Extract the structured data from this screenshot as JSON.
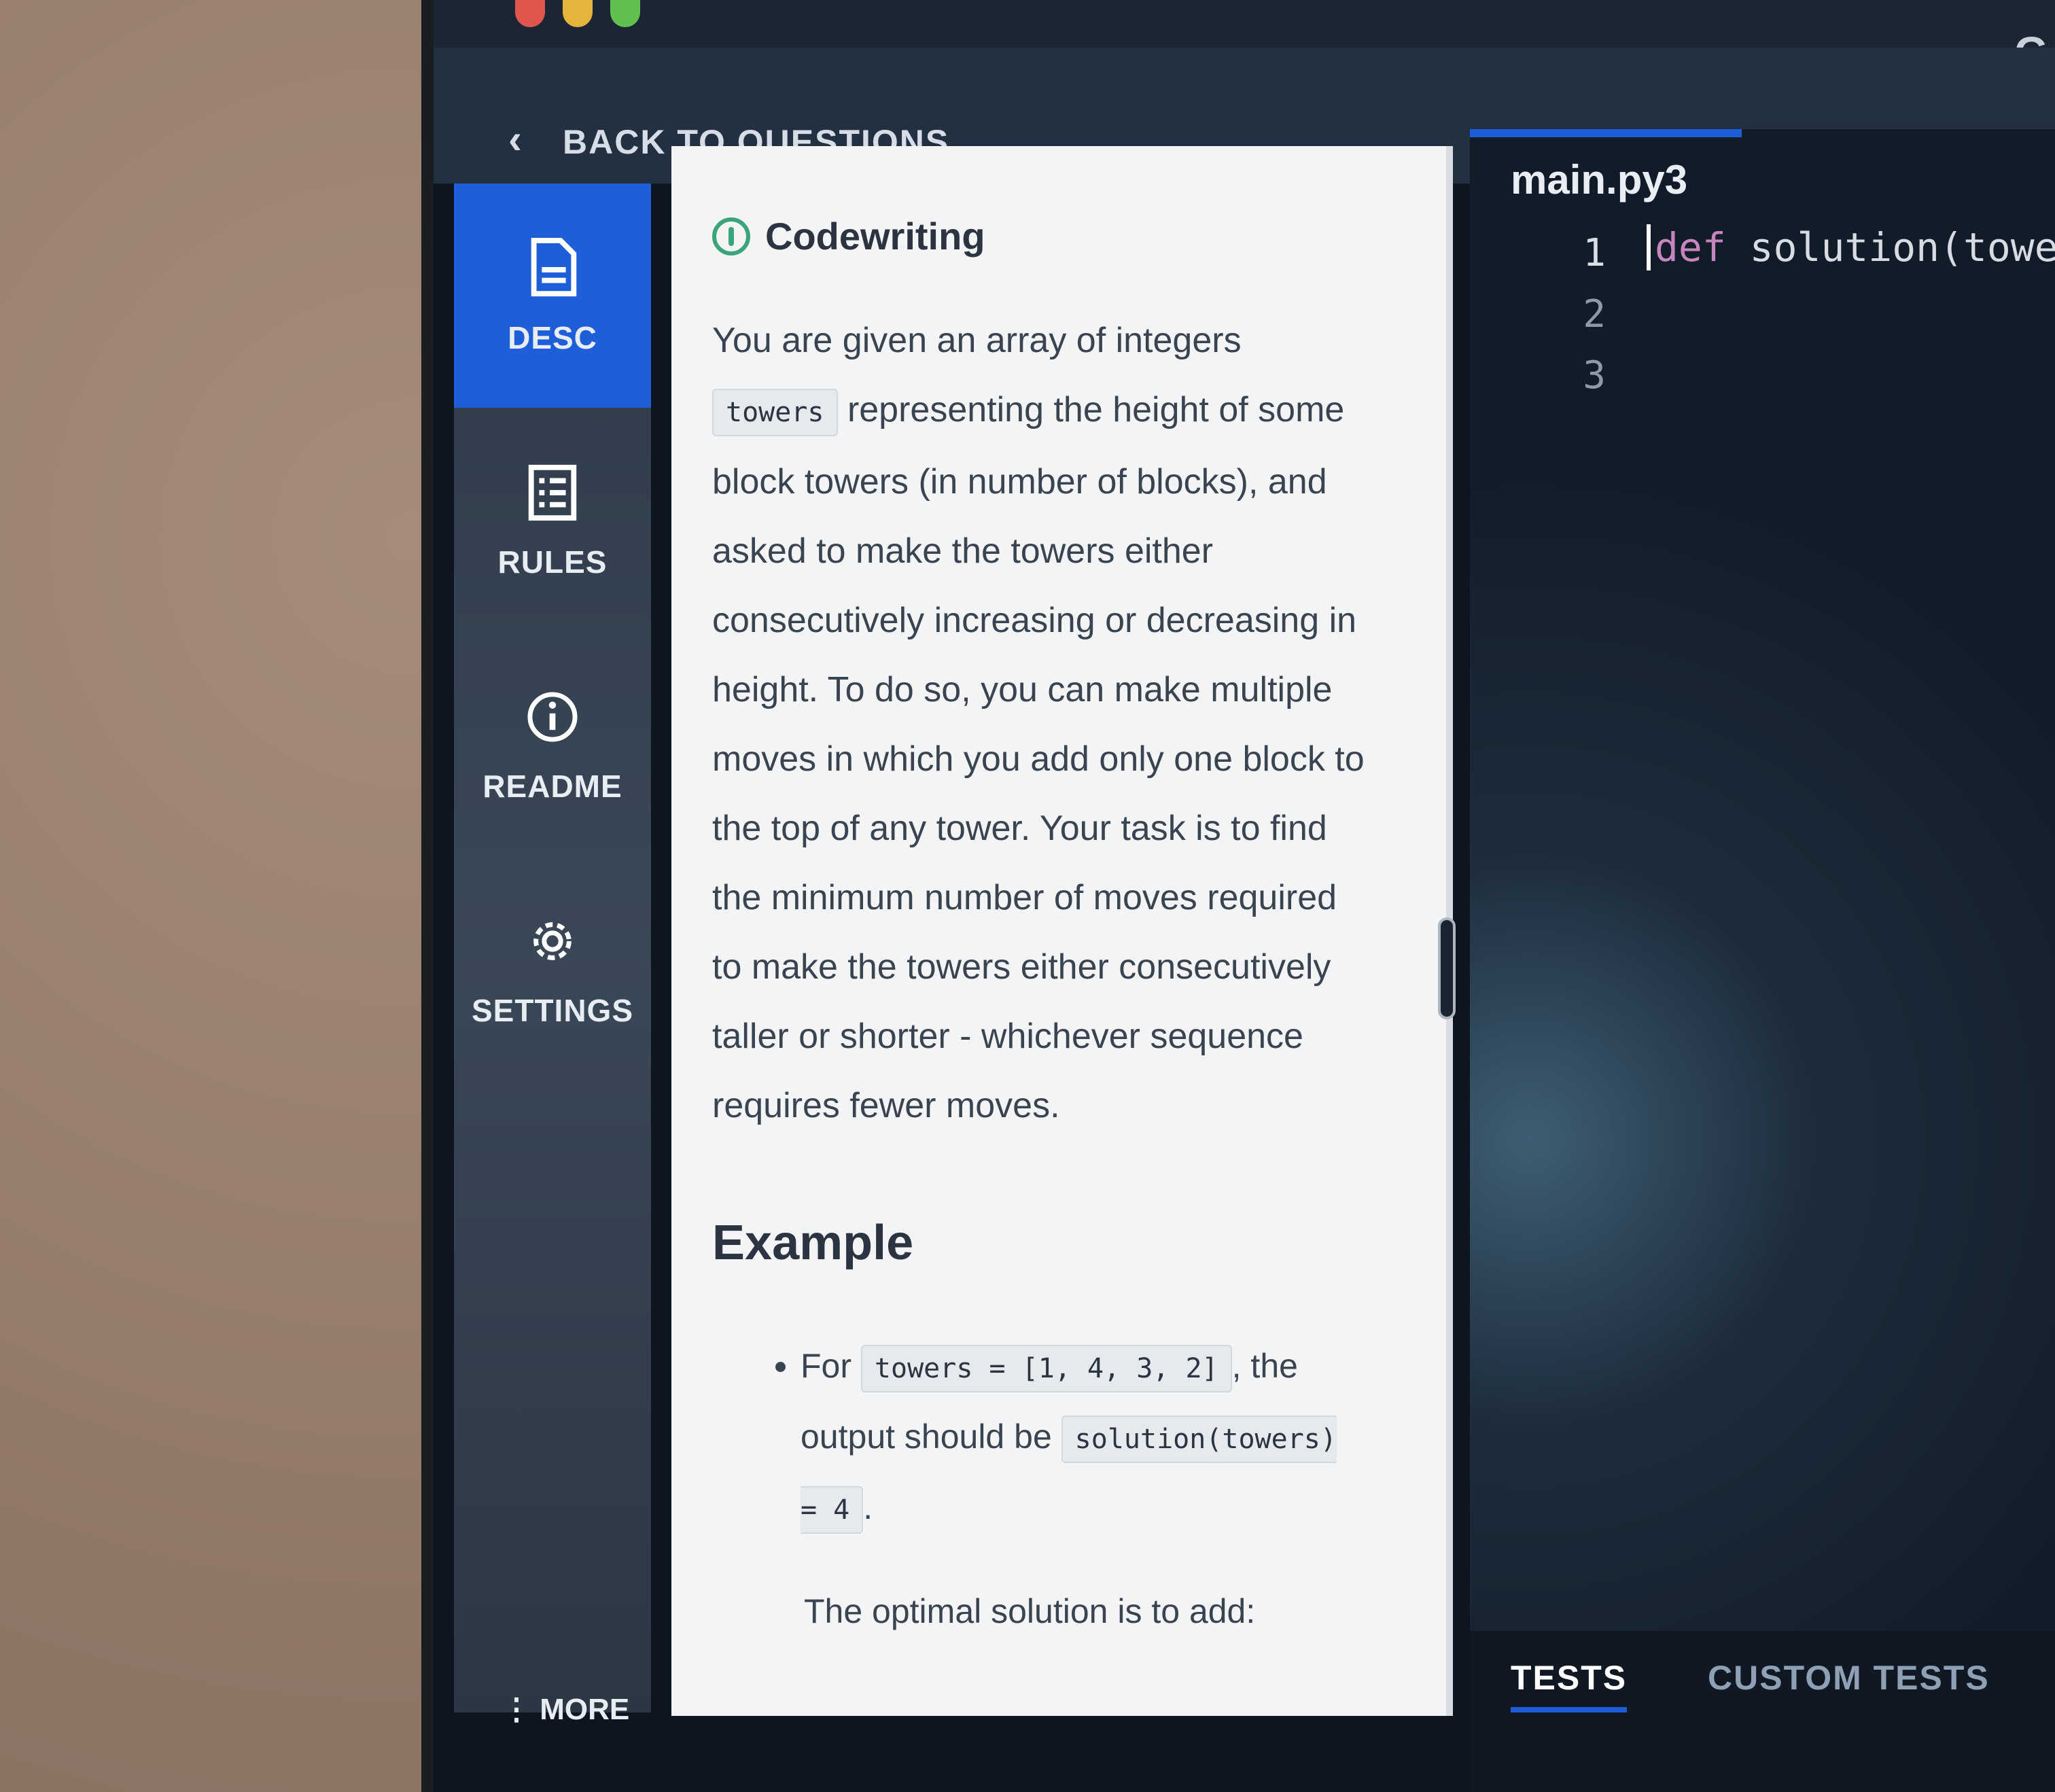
{
  "nav": {
    "back_label": "BACK TO QUESTIONS"
  },
  "sidebar": {
    "items": [
      {
        "label": "DESC",
        "icon": "document-icon",
        "active": true
      },
      {
        "label": "RULES",
        "icon": "list-icon",
        "active": false
      },
      {
        "label": "README",
        "icon": "info-icon",
        "active": false
      },
      {
        "label": "SETTINGS",
        "icon": "gear-icon",
        "active": false
      }
    ],
    "more_label": "MORE"
  },
  "description": {
    "type_label": "Codewriting",
    "intro_1": "You are given an array of integers",
    "intro_code": "towers",
    "intro_2": " representing the height of some block towers (in number of blocks), and asked to make the towers either consecutively increasing or decreasing in height. To do so, you can make multiple moves in which you add only one block to the top of any tower. Your task is to find the minimum number of moves required to make the towers either consecutively taller or shorter - whichever sequence requires fewer moves.",
    "example_heading": "Example",
    "example_for": "For ",
    "example_input": "towers = [1, 4, 3, 2]",
    "example_mid": ", the output should be ",
    "example_output": "solution(towers) = 4",
    "example_end": ".",
    "optimal_text": "The optimal solution is to add:"
  },
  "editor": {
    "filename": "main.py3",
    "line_numbers": [
      "1",
      "2",
      "3"
    ],
    "code_keyword": "def",
    "code_rest": " solution(towe"
  },
  "bottom_tabs": {
    "tests": "TESTS",
    "custom_tests": "CUSTOM TESTS"
  },
  "colors": {
    "accent": "#1e5fd9",
    "codewriting_green": "#3aa57a"
  }
}
